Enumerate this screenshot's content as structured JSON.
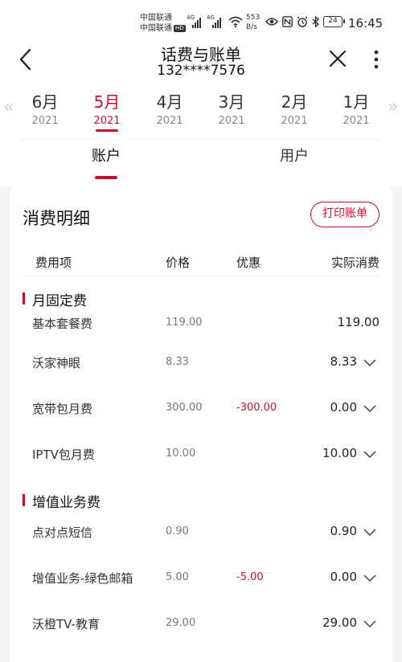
{
  "status": {
    "carrier1": "中国联通",
    "carrier2": "中国联通",
    "hd": "HD",
    "net1": "4G",
    "net2": "4G",
    "speed_value": "553",
    "speed_unit": "B/s",
    "battery": "24",
    "time": "16:45"
  },
  "header": {
    "title": "话费与账单",
    "phone": "132****7576"
  },
  "months": [
    {
      "month": "6月",
      "year": "2021"
    },
    {
      "month": "5月",
      "year": "2021"
    },
    {
      "month": "4月",
      "year": "2021"
    },
    {
      "month": "3月",
      "year": "2021"
    },
    {
      "month": "2月",
      "year": "2021"
    },
    {
      "month": "1月",
      "year": "2021"
    }
  ],
  "active_month_index": 1,
  "tabs": [
    "账户",
    "用户"
  ],
  "detail": {
    "title": "消费明细",
    "print_label": "打印账单",
    "columns": [
      "费用项",
      "价格",
      "优惠",
      "实际消费"
    ],
    "sections": [
      {
        "title": "月固定费",
        "rows": [
          {
            "name": "基本套餐费",
            "price": "119.00",
            "discount": "",
            "actual": "119.00",
            "expandable": false
          },
          {
            "name": "沃家神眼",
            "price": "8.33",
            "discount": "",
            "actual": "8.33",
            "expandable": true
          },
          {
            "name": "宽带包月费",
            "price": "300.00",
            "discount": "-300.00",
            "actual": "0.00",
            "expandable": true
          },
          {
            "name": "IPTV包月费",
            "price": "10.00",
            "discount": "",
            "actual": "10.00",
            "expandable": true
          }
        ]
      },
      {
        "title": "增值业务费",
        "rows": [
          {
            "name": "点对点短信",
            "price": "0.90",
            "discount": "",
            "actual": "0.90",
            "expandable": true
          },
          {
            "name": "增值业务-绿色邮箱",
            "price": "5.00",
            "discount": "-5.00",
            "actual": "0.00",
            "expandable": true
          },
          {
            "name": "沃橙TV-教育",
            "price": "29.00",
            "discount": "",
            "actual": "29.00",
            "expandable": true
          }
        ]
      }
    ]
  },
  "colors": {
    "accent": "#c8102e",
    "background": "#f4f4f4",
    "card": "#ffffff"
  }
}
